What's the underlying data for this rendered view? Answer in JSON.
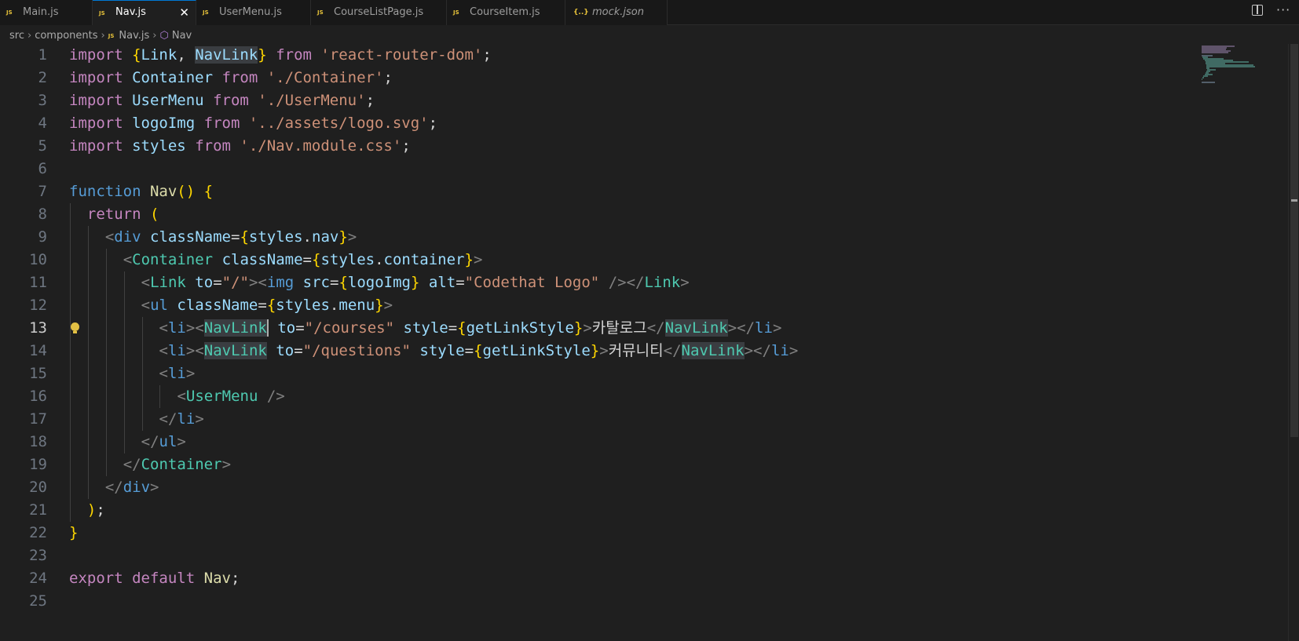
{
  "tabs": [
    {
      "label": "Main.js",
      "icon": "js-file-icon",
      "active": false,
      "italic": false
    },
    {
      "label": "Nav.js",
      "icon": "js-file-icon",
      "active": true,
      "italic": false
    },
    {
      "label": "UserMenu.js",
      "icon": "js-file-icon",
      "active": false,
      "italic": false
    },
    {
      "label": "CourseListPage.js",
      "icon": "js-file-icon",
      "active": false,
      "italic": false
    },
    {
      "label": "CourseItem.js",
      "icon": "js-file-icon",
      "active": false,
      "italic": false
    },
    {
      "label": "mock.json",
      "icon": "json-file-icon",
      "active": false,
      "italic": true
    }
  ],
  "tab_close_glyph": "✕",
  "js_icon_text": "JS",
  "json_icon_text": "{..}",
  "breadcrumb": {
    "items": [
      "src",
      "components",
      "Nav.js",
      "Nav"
    ]
  },
  "editor": {
    "current_line": 13,
    "lines": [
      "import {Link, NavLink} from 'react-router-dom';",
      "import Container from './Container';",
      "import UserMenu from './UserMenu';",
      "import logoImg from '../assets/logo.svg';",
      "import styles from './Nav.module.css';",
      "",
      "function Nav() {",
      "  return (",
      "    <div className={styles.nav}>",
      "      <Container className={styles.container}>",
      "        <Link to=\"/\"><img src={logoImg} alt=\"Codethat Logo\" /></Link>",
      "        <ul className={styles.menu}>",
      "          <li><NavLink to=\"/courses\" style={getLinkStyle}>카탈로그</NavLink></li>",
      "          <li><NavLink to=\"/questions\" style={getLinkStyle}>커뮤니티</NavLink></li>",
      "          <li>",
      "            <UserMenu />",
      "          </li>",
      "        </ul>",
      "      </Container>",
      "    </div>",
      "  );",
      "}",
      "",
      "export default Nav;",
      ""
    ]
  },
  "colors": {
    "keyword": "#c586c0",
    "string": "#ce9178",
    "variable": "#9cdcfe",
    "component": "#4ec9b0",
    "function": "#dcdcaa",
    "tag": "#569cd6",
    "accent": "#0078d4"
  }
}
